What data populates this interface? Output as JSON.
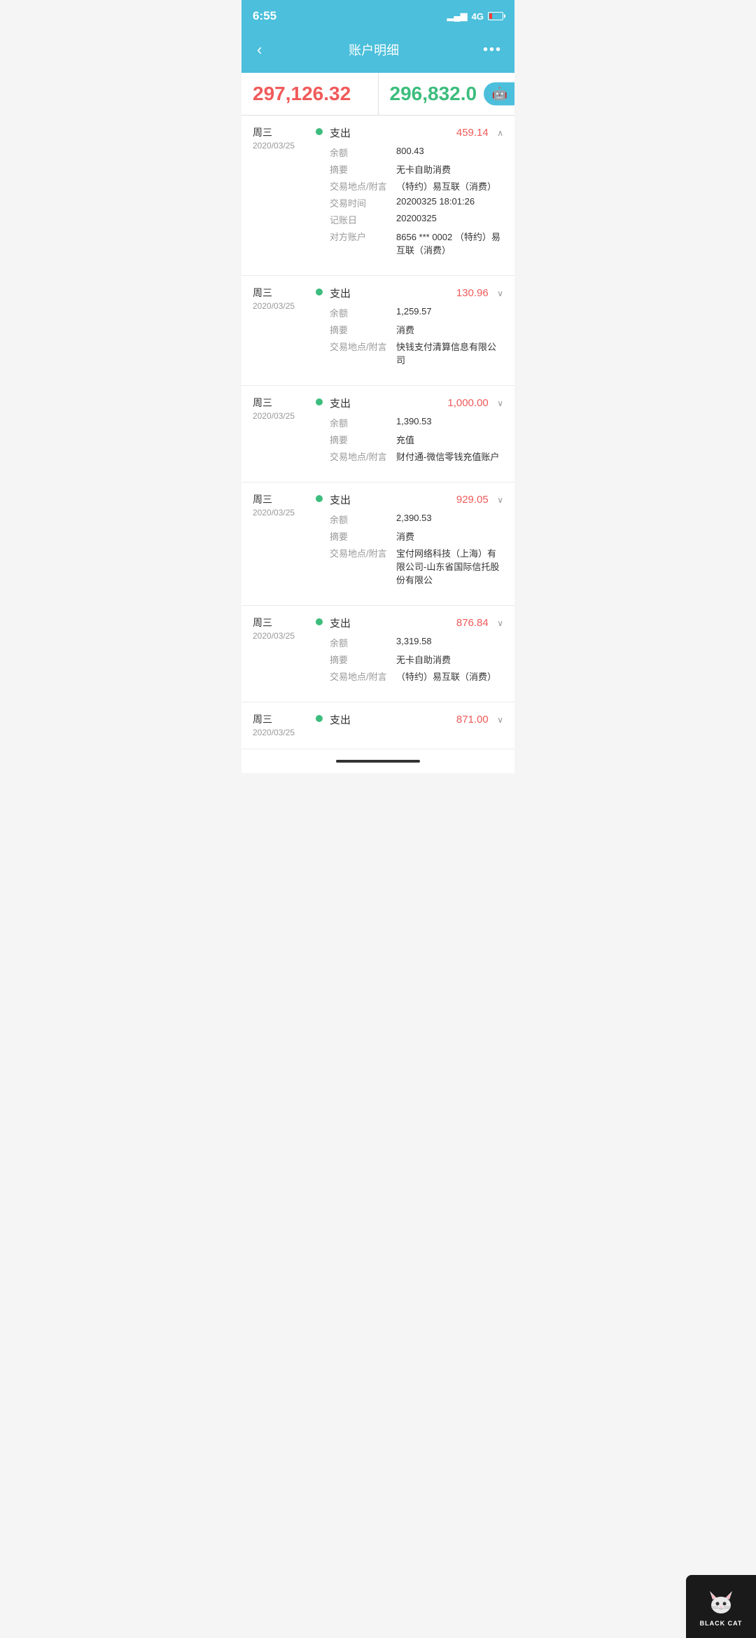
{
  "statusBar": {
    "time": "6:55",
    "signal": "▂▄▆",
    "network": "4G",
    "battery": "low"
  },
  "header": {
    "backLabel": "‹",
    "title": "账户明细",
    "moreLabel": "•••"
  },
  "balanceRow": {
    "leftAmount": "297,126.32",
    "rightAmount": "296,832.0",
    "robotIcon": "🤖"
  },
  "transactions": [
    {
      "day": "周三",
      "date": "2020/03/25",
      "type": "支出",
      "amount": "459.14",
      "amountColor": "red",
      "expanded": true,
      "chevron": "∧",
      "details": [
        {
          "label": "余额",
          "value": "800.43"
        },
        {
          "label": "摘要",
          "value": "无卡自助消费"
        },
        {
          "label": "交易地点/附言",
          "value": "（特约）易互联（消费）"
        },
        {
          "label": "交易时间",
          "value": "20200325 18:01:26"
        },
        {
          "label": "记账日",
          "value": "20200325"
        },
        {
          "label": "对方账户",
          "value": "8656 *** 0002 （特约）易互联（消费）"
        }
      ]
    },
    {
      "day": "周三",
      "date": "2020/03/25",
      "type": "支出",
      "amount": "130.96",
      "amountColor": "red",
      "expanded": false,
      "chevron": "∨",
      "details": [
        {
          "label": "余额",
          "value": "1,259.57"
        },
        {
          "label": "摘要",
          "value": "消费"
        },
        {
          "label": "交易地点/附言",
          "value": "快钱支付清算信息有限公司"
        }
      ]
    },
    {
      "day": "周三",
      "date": "2020/03/25",
      "type": "支出",
      "amount": "1,000.00",
      "amountColor": "red",
      "expanded": false,
      "chevron": "∨",
      "details": [
        {
          "label": "余额",
          "value": "1,390.53"
        },
        {
          "label": "摘要",
          "value": "充值"
        },
        {
          "label": "交易地点/附言",
          "value": "财付通-微信零钱充值账户"
        }
      ]
    },
    {
      "day": "周三",
      "date": "2020/03/25",
      "type": "支出",
      "amount": "929.05",
      "amountColor": "red",
      "expanded": false,
      "chevron": "∨",
      "details": [
        {
          "label": "余额",
          "value": "2,390.53"
        },
        {
          "label": "摘要",
          "value": "消费"
        },
        {
          "label": "交易地点/附言",
          "value": "宝付网络科技（上海）有限公司-山东省国际信托股份有限公"
        }
      ]
    },
    {
      "day": "周三",
      "date": "2020/03/25",
      "type": "支出",
      "amount": "876.84",
      "amountColor": "red",
      "expanded": false,
      "chevron": "∨",
      "details": [
        {
          "label": "余额",
          "value": "3,319.58"
        },
        {
          "label": "摘要",
          "value": "无卡自助消费"
        },
        {
          "label": "交易地点/附言",
          "value": "（特约）易互联（消费）"
        }
      ]
    }
  ],
  "partialTransaction": {
    "day": "周三",
    "date": "2020/03/25",
    "type": "支出",
    "amount": "871.00",
    "chevron": "∨"
  },
  "blackCat": {
    "label": "BLACK CAT"
  }
}
